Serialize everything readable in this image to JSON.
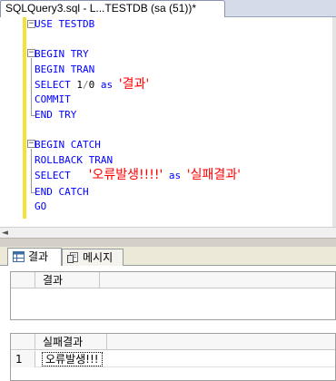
{
  "document_tab": {
    "title": "SQLQuery3.sql - L...TESTDB (sa (51))*"
  },
  "editor": {
    "lines": {
      "l1": {
        "kw": "USE TESTDB"
      },
      "l2": {
        "kw": "BEGIN TRY"
      },
      "l3": {
        "kw": "BEGIN TRAN"
      },
      "l4": {
        "kw": "SELECT",
        "num1": "1",
        "op": "/",
        "num2": "0",
        "kw2": "as",
        "str": "'결과'"
      },
      "l5": {
        "kw": "COMMIT"
      },
      "l6": {
        "kw": "END TRY"
      },
      "l7": {
        "kw": "BEGIN CATCH"
      },
      "l8": {
        "kw": "ROLLBACK TRAN"
      },
      "l9": {
        "kw": "SELECT",
        "str1": "'오류발생!!!!'",
        "kw2": "as",
        "str2": "'실패결과'"
      },
      "l10": {
        "kw": "END CATCH"
      },
      "l11": {
        "kw": "GO"
      }
    }
  },
  "results": {
    "tabs": [
      {
        "label": "결과",
        "icon": "grid-icon",
        "active": true
      },
      {
        "label": "메시지",
        "icon": "message-doc-icon",
        "active": false
      }
    ],
    "grid1": {
      "columns": [
        "결과"
      ],
      "rows": []
    },
    "grid2": {
      "columns": [
        "실패결과"
      ],
      "rows": [
        {
          "num": "1",
          "value": "오류발생!!!"
        }
      ]
    }
  },
  "colors": {
    "keyword": "#0000ff",
    "string": "#ff0000",
    "operator": "#808080",
    "margin_indicator": "#f2e23a"
  }
}
